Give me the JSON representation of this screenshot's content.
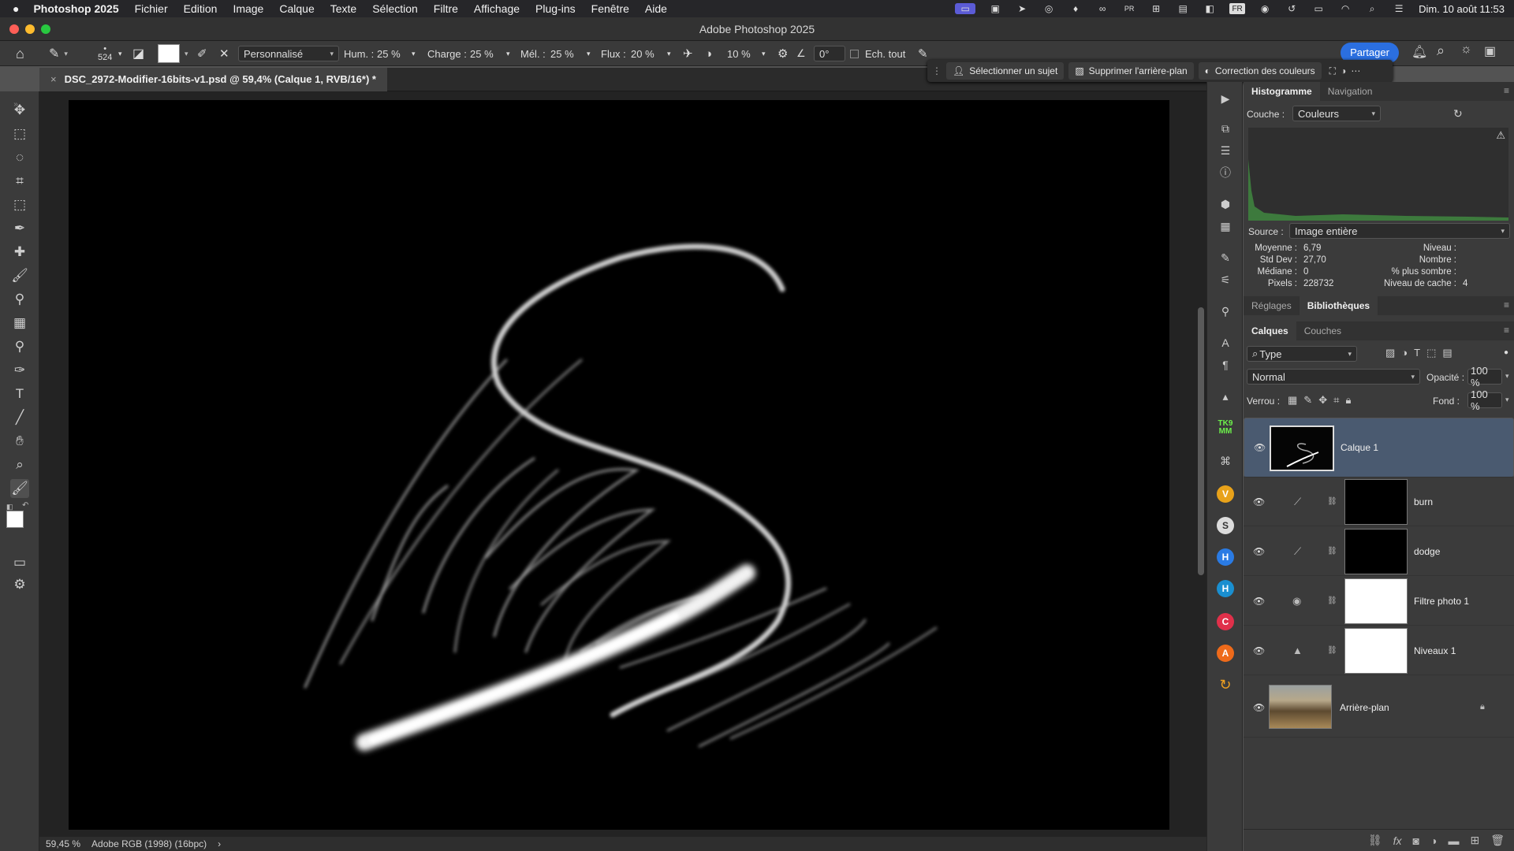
{
  "menubar": {
    "apple": "",
    "app_name": "Photoshop 2025",
    "items": [
      "Fichier",
      "Edition",
      "Image",
      "Calque",
      "Texte",
      "Sélection",
      "Filtre",
      "Affichage",
      "Plug-ins",
      "Fenêtre",
      "Aide"
    ],
    "input_source": "FR",
    "datetime": "Dim. 10 août 11:53"
  },
  "window": {
    "title": "Adobe Photoshop 2025"
  },
  "options": {
    "brush_size": "524",
    "preset": "Personnalisé",
    "hum_label": "Hum. :",
    "hum": "25 %",
    "charge_label": "Charge :",
    "charge": "25 %",
    "mel_label": "Mél. :",
    "mel": "25 %",
    "flux_label": "Flux :",
    "flux": "20 %",
    "smoothing": "10 %",
    "angle": "0°",
    "sample_all": "Ech. tout"
  },
  "share_label": "Partager",
  "context_bar": {
    "select_subject": "Sélectionner un sujet",
    "remove_bg": "Supprimer l'arrière-plan",
    "color_correct": "Correction des couleurs"
  },
  "document": {
    "tab_title": "DSC_2972-Modifier-16bits-v1.psd @ 59,4% (Calque 1, RVB/16*) *",
    "zoom": "59,45 %",
    "profile": "Adobe RGB (1998) (16bpc)"
  },
  "histogram": {
    "tabs": [
      "Histogramme",
      "Navigation"
    ],
    "couche_label": "Couche :",
    "couche": "Couleurs",
    "source_label": "Source :",
    "source": "Image entière",
    "stats_left": [
      {
        "k": "Moyenne :",
        "v": "6,79"
      },
      {
        "k": "Std Dev :",
        "v": "27,70"
      },
      {
        "k": "Médiane :",
        "v": "0"
      },
      {
        "k": "Pixels :",
        "v": "228732"
      }
    ],
    "stats_right": [
      {
        "k": "Niveau :",
        "v": ""
      },
      {
        "k": "Nombre :",
        "v": ""
      },
      {
        "k": "% plus sombre :",
        "v": ""
      },
      {
        "k": "Niveau de cache :",
        "v": "4"
      }
    ]
  },
  "adjust_tabs": [
    "Réglages",
    "Bibliothèques"
  ],
  "layers": {
    "tabs": [
      "Calques",
      "Couches"
    ],
    "filter_type": "Type",
    "blend_mode": "Normal",
    "opacity_label": "Opacité :",
    "opacity": "100 %",
    "lock_label": "Verrou :",
    "fill_label": "Fond :",
    "fill": "100 %",
    "items": [
      {
        "name": "Calque 1"
      },
      {
        "name": "burn"
      },
      {
        "name": "dodge"
      },
      {
        "name": "Filtre photo 1"
      },
      {
        "name": "Niveaux 1"
      },
      {
        "name": "Arrière-plan"
      }
    ]
  },
  "plugins": [
    "TK9 MM",
    "V",
    "S",
    "H",
    "H",
    "C",
    "A"
  ],
  "colors": {
    "accent": "#2b6fe0",
    "selected_layer": "#4a5a70"
  }
}
